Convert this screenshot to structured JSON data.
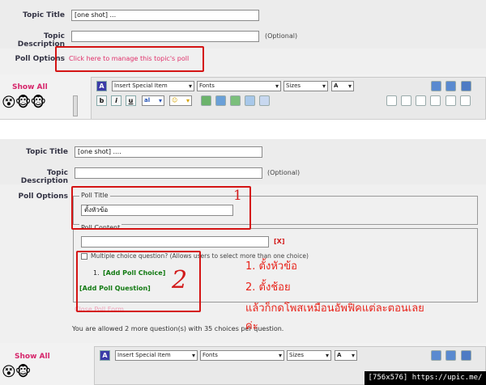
{
  "top": {
    "topic_title_label": "Topic Title",
    "topic_title_value": "[one shot] ...",
    "topic_desc_label": "Topic Description",
    "optional": "(Optional)",
    "poll_options_label": "Poll Options",
    "manage_poll_link": "Click here to manage this topic's poll",
    "show_all": "Show All",
    "faces": "😵🐵🐵",
    "special_item": "Insert Special Item",
    "fonts": "Fonts",
    "sizes": "Sizes",
    "font_color": "A",
    "bold": "b",
    "italic": "i",
    "underline": "u",
    "subscript": "al",
    "smiley": "☺"
  },
  "bottom": {
    "topic_title_label": "Topic Title",
    "topic_title_value": "[one shot] ....",
    "topic_desc_label": "Topic Description",
    "optional": "(Optional)",
    "poll_options_label": "Poll Options",
    "poll_title_legend": "Poll Title",
    "poll_title_value": "ตั้งหัวข้อ",
    "poll_content_legend": "Poll Content",
    "remove_x": "[X]",
    "multiple_choice": "Multiple choice question? (Allows users to select more than one choice)",
    "choice_number": "1.",
    "add_poll_choice": "[Add Poll Choice]",
    "add_poll_question": "[Add Poll Question]",
    "close_poll_form": "Close Poll Form",
    "allowed_text": "You are allowed 2 more question(s) with 35 choices per question.",
    "show_all": "Show All",
    "faces": "😵🐵",
    "special_item": "Insert Special Item",
    "fonts": "Fonts",
    "sizes": "Sizes",
    "font_color": "A"
  },
  "annotations": {
    "number_1": "1",
    "number_2": "2",
    "line1": "1. ตั้งหัวข้อ",
    "line2": "2. ตั้งช้อย",
    "line3": "แล้วก็กดโพสเหมือนอัพฟิคแต่ละตอนเลย",
    "line4": "ค่ะ"
  },
  "footer": "[756x576] https://upic.me/",
  "colors": {
    "annotation_red": "#d41414",
    "link_pink": "#e0306a",
    "add_green": "#137a13"
  }
}
